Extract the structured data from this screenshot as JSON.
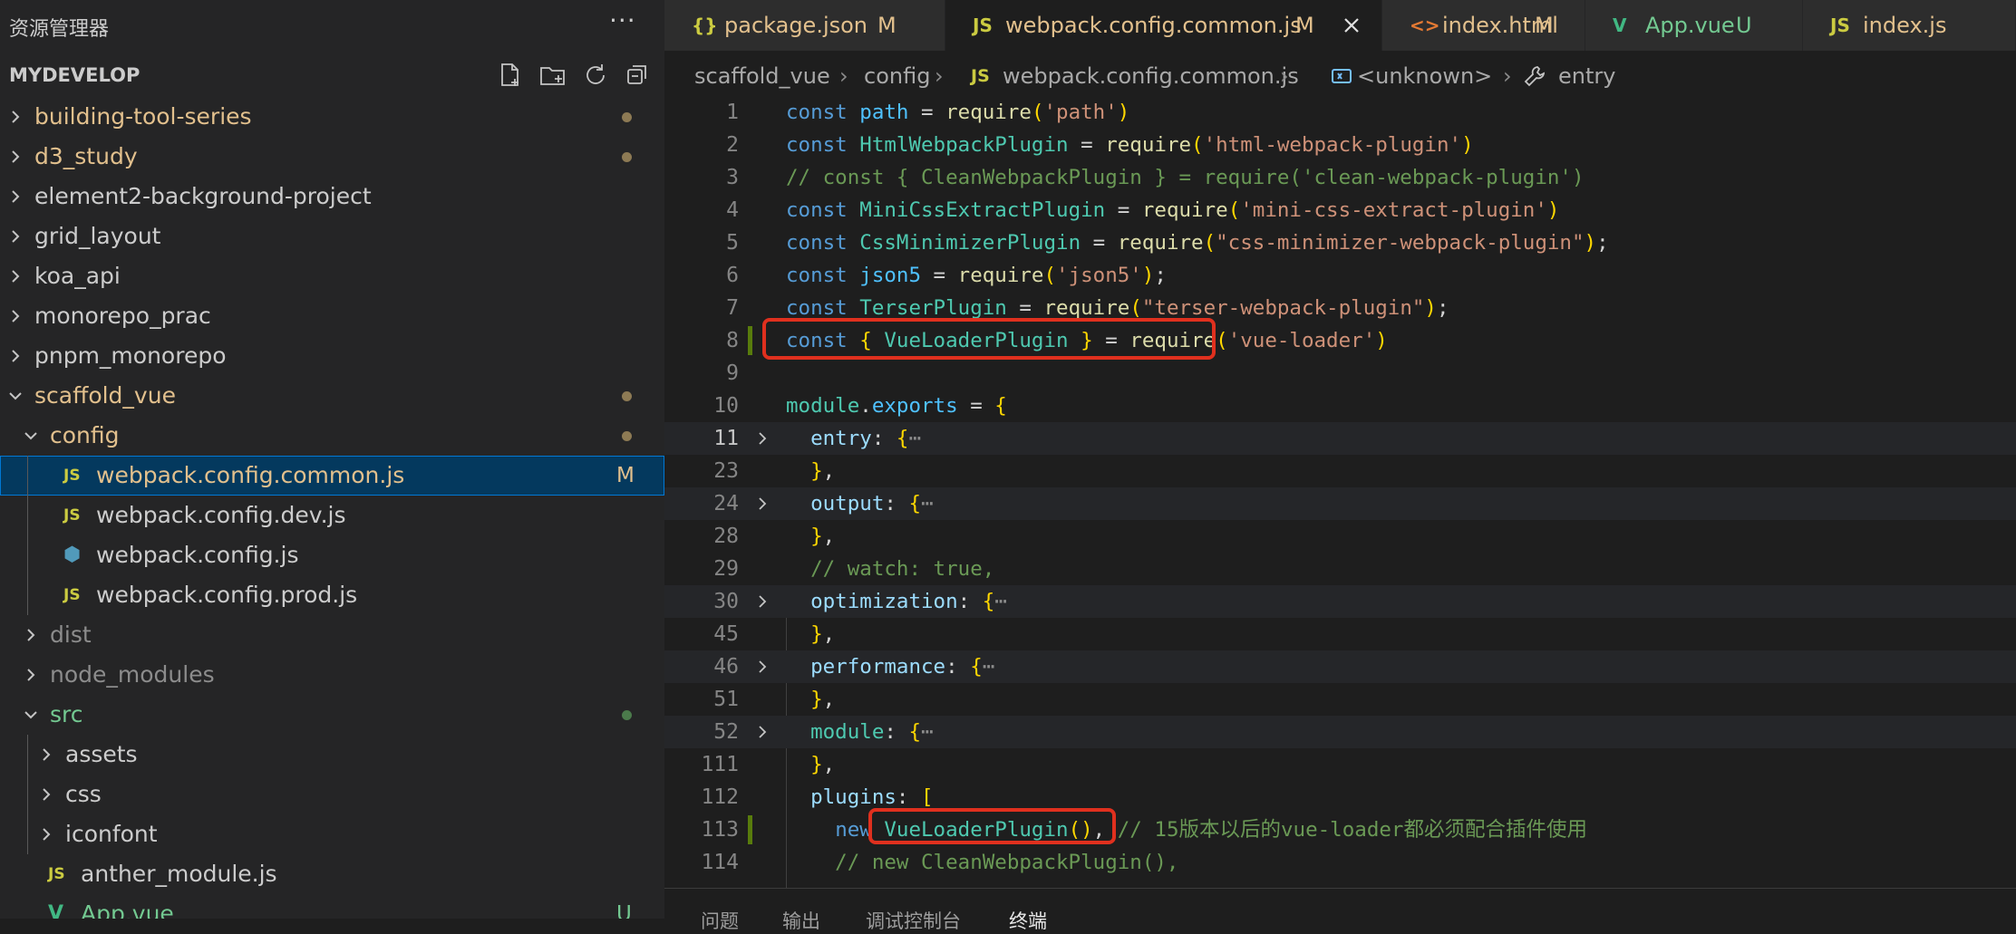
{
  "sidebar": {
    "title": "资源管理器",
    "more": "···",
    "workspace": "MYDEVELOP",
    "tree": [
      {
        "label": "building-tool-series",
        "type": "folder",
        "expanded": false,
        "color": "mod",
        "dot": true
      },
      {
        "label": "d3_study",
        "type": "folder",
        "expanded": false,
        "color": "mod",
        "dot": true
      },
      {
        "label": "element2-background-project",
        "type": "folder",
        "expanded": false,
        "color": "plain"
      },
      {
        "label": "grid_layout",
        "type": "folder",
        "expanded": false,
        "color": "plain"
      },
      {
        "label": "koa_api",
        "type": "folder",
        "expanded": false,
        "color": "plain"
      },
      {
        "label": "monorepo_prac",
        "type": "folder",
        "expanded": false,
        "color": "plain"
      },
      {
        "label": "pnpm_monorepo",
        "type": "folder",
        "expanded": false,
        "color": "plain"
      },
      {
        "label": "scaffold_vue",
        "type": "folder",
        "expanded": true,
        "color": "mod",
        "dot": true
      },
      {
        "label": "config",
        "type": "folder",
        "expanded": true,
        "color": "mod",
        "dot": true
      },
      {
        "label": "webpack.config.common.js",
        "type": "file",
        "icon": "JS",
        "color": "mod",
        "badge": "M",
        "selected": true
      },
      {
        "label": "webpack.config.dev.js",
        "type": "file",
        "icon": "JS",
        "color": "plain"
      },
      {
        "label": "webpack.config.js",
        "type": "file",
        "icon": "cube",
        "color": "plain"
      },
      {
        "label": "webpack.config.prod.js",
        "type": "file",
        "icon": "JS",
        "color": "plain"
      },
      {
        "label": "dist",
        "type": "folder",
        "expanded": false,
        "color": "dim"
      },
      {
        "label": "node_modules",
        "type": "folder",
        "expanded": false,
        "color": "dim"
      },
      {
        "label": "src",
        "type": "folder",
        "expanded": true,
        "color": "green",
        "dot": true
      },
      {
        "label": "assets",
        "type": "folder",
        "expanded": false,
        "color": "plain"
      },
      {
        "label": "css",
        "type": "folder",
        "expanded": false,
        "color": "plain"
      },
      {
        "label": "iconfont",
        "type": "folder",
        "expanded": false,
        "color": "plain"
      },
      {
        "label": "anther_module.js",
        "type": "file",
        "icon": "JS",
        "color": "plain"
      },
      {
        "label": "App.vue",
        "type": "file",
        "icon": "vue",
        "color": "green",
        "badge": "U"
      }
    ]
  },
  "tabs": [
    {
      "icon": "{}",
      "label": "package.json",
      "status": "M",
      "active": false
    },
    {
      "icon": "JS",
      "label": "webpack.config.common.js",
      "status": "M",
      "active": true
    },
    {
      "icon": "<>",
      "label": "index.html",
      "status": "M",
      "active": false
    },
    {
      "icon": "V",
      "label": "App.vue",
      "status": "U",
      "active": false
    },
    {
      "icon": "JS",
      "label": "index.js",
      "status": "",
      "active": false
    }
  ],
  "breadcrumb": {
    "root": "scaffold_vue",
    "folder": "config",
    "file_icon": "JS",
    "file": "webpack.config.common.js",
    "symbol": "<unknown>",
    "prop": "entry"
  },
  "editor": {
    "lines": [
      {
        "n": "1",
        "text": "const path = require('path')"
      },
      {
        "n": "2",
        "text": "const HtmlWebpackPlugin = require('html-webpack-plugin')"
      },
      {
        "n": "3",
        "text": "// const { CleanWebpackPlugin } = require('clean-webpack-plugin')"
      },
      {
        "n": "4",
        "text": "const MiniCssExtractPlugin = require('mini-css-extract-plugin')"
      },
      {
        "n": "5",
        "text": "const CssMinimizerPlugin = require(\"css-minimizer-webpack-plugin\");"
      },
      {
        "n": "6",
        "text": "const json5 = require('json5');"
      },
      {
        "n": "7",
        "text": "const TerserPlugin = require(\"terser-webpack-plugin\");"
      },
      {
        "n": "8",
        "text": "const { VueLoaderPlugin } = require('vue-loader')"
      },
      {
        "n": "9",
        "text": ""
      },
      {
        "n": "10",
        "text": "module.exports = {"
      },
      {
        "n": "11",
        "text": "  entry: {⋯"
      },
      {
        "n": "23",
        "text": "  },"
      },
      {
        "n": "24",
        "text": "  output: {⋯"
      },
      {
        "n": "28",
        "text": "  },"
      },
      {
        "n": "29",
        "text": "  // watch: true,"
      },
      {
        "n": "30",
        "text": "  optimization: {⋯"
      },
      {
        "n": "45",
        "text": "  },"
      },
      {
        "n": "46",
        "text": "  performance: {⋯"
      },
      {
        "n": "51",
        "text": "  },"
      },
      {
        "n": "52",
        "text": "  module: {⋯"
      },
      {
        "n": "111",
        "text": "  },"
      },
      {
        "n": "112",
        "text": "  plugins: ["
      },
      {
        "n": "113",
        "text": "    new VueLoaderPlugin(), // 15版本以后的vue-loader都必须配合插件使用"
      },
      {
        "n": "114",
        "text": "    // new CleanWebpackPlugin(),"
      }
    ]
  },
  "panel": {
    "tabs": [
      "问题",
      "输出",
      "调试控制台",
      "终端"
    ]
  },
  "colors": {
    "callout": "#e0301e",
    "modified": "#e2c08d",
    "untracked": "#73c991",
    "git_added_bar": "#587c0c",
    "selection": "#04395e"
  }
}
